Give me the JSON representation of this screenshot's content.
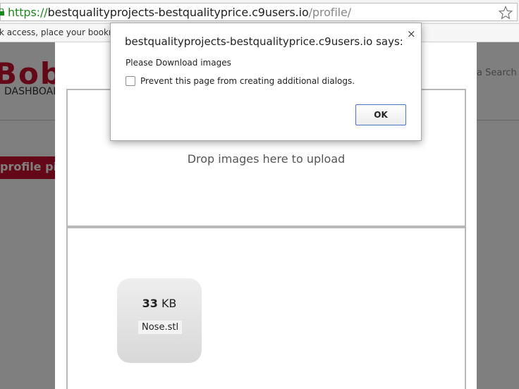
{
  "browser": {
    "url_scheme": "https://",
    "url_host": "bestqualityprojects-bestqualityprice.c9users.io",
    "url_path": "/profile/",
    "bookmark_hint": "k access, place your bookmark"
  },
  "page": {
    "logo": "Bob",
    "nav_dashboard": "DASHBOAR",
    "search_hint": "a Search",
    "profile_pic_button": "profile pic"
  },
  "modal": {
    "drop_text": "Drop images here to upload",
    "file": {
      "size_number": "33",
      "size_unit": "KB",
      "name": "Nose.stl"
    }
  },
  "dialog": {
    "title": "bestqualityprojects-bestqualityprice.c9users.io says:",
    "close": "×",
    "message": "Please Download images",
    "checkbox_label": "Prevent this page from creating additional dialogs.",
    "ok_label": "OK"
  },
  "colors": {
    "brand": "#c8102e",
    "url_green": "#1a8a1a",
    "ok_border": "#4a74c9"
  }
}
